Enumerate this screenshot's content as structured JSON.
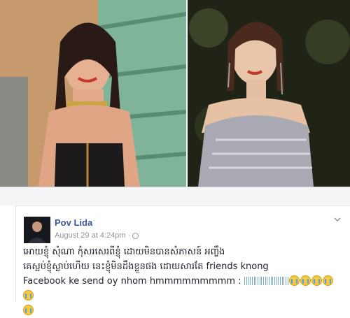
{
  "post": {
    "author": "Pov Lida",
    "timestamp": "August 29 at 4:24pm",
    "separator": "·",
    "text_line1": "អោយខ្ញុំ សុំណា កុំសរសេរពីខ្ញុំ ដោយមិនបានសំភាសន៍ អញ្ចឹង",
    "text_line2": "គេស្អប់ខ្ញុំស្លាប់ហើយ នេះខ្ញុំមិនដឹងខ្លួនផង ដោយសារតែ friends knong",
    "text_line3": "Facebook ke send oy nhom hmmmmmmmmm : ",
    "trickle_count": 8,
    "emoji_count": 6,
    "visibility_icon": "globe-icon",
    "menu_icon": "chevron-down-icon"
  },
  "colors": {
    "author_link": "#3b5998",
    "meta_gray": "#90949c",
    "text": "#1d2129"
  }
}
